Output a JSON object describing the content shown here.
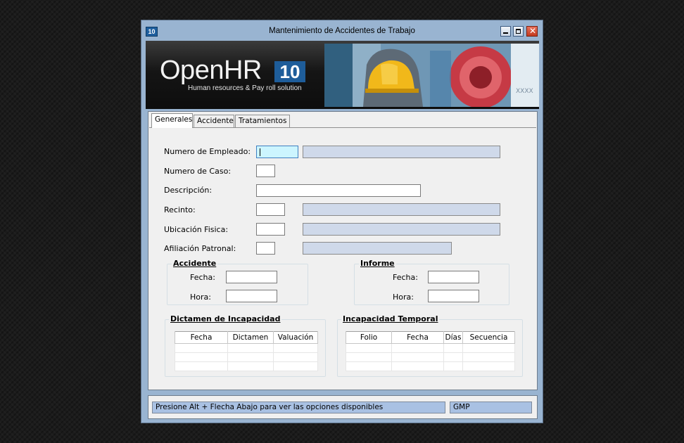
{
  "window": {
    "title": "Mantenimiento de Accidentes de Trabajo",
    "icon_text": "10",
    "controls": [
      "minimize-icon",
      "maximize-icon",
      "close-icon"
    ]
  },
  "banner": {
    "logo_text": "OpenHR",
    "logo_number": "10",
    "tagline": "Human resources & Pay roll solution"
  },
  "tabs": [
    "Generales",
    "Accidente",
    "Tratamientos"
  ],
  "form": {
    "numero_empleado": {
      "label": "Numero de Empleado:",
      "value": "",
      "name": ""
    },
    "numero_caso": {
      "label": "Numero de Caso:",
      "value": ""
    },
    "descripcion": {
      "label": "Descripción:",
      "value": ""
    },
    "recinto": {
      "label": "Recinto:",
      "value": "",
      "name": ""
    },
    "ubicacion": {
      "label": "Ubicación Fisica:",
      "value": "",
      "name": ""
    },
    "afiliacion": {
      "label": "Afiliación Patronal:",
      "value": "",
      "name": ""
    }
  },
  "accidente": {
    "title": "Accidente",
    "fecha_label": "Fecha:",
    "hora_label": "Hora:",
    "fecha": "",
    "hora": ""
  },
  "informe": {
    "title": "Informe",
    "fecha_label": "Fecha:",
    "hora_label": "Hora:",
    "fecha": "",
    "hora": ""
  },
  "dictamen": {
    "title": "Dictamen de Incapacidad",
    "columns": [
      "Fecha",
      "Dictamen",
      "Valuación"
    ],
    "rows": []
  },
  "incapacidad": {
    "title": "Incapacidad Temporal",
    "columns": [
      "Folio",
      "Fecha",
      "Días",
      "Secuencia"
    ],
    "rows": []
  },
  "status": {
    "message": "Presione Alt + Flecha Abajo para ver las opciones disponibles",
    "company": "GMP"
  },
  "colors": {
    "titlebar": "#99b4d1",
    "readonly_field": "#cfd9ea",
    "focused_field": "#ccf5ff",
    "status_panel": "#a9c1e3",
    "logo_badge": "#1e5d9a"
  }
}
